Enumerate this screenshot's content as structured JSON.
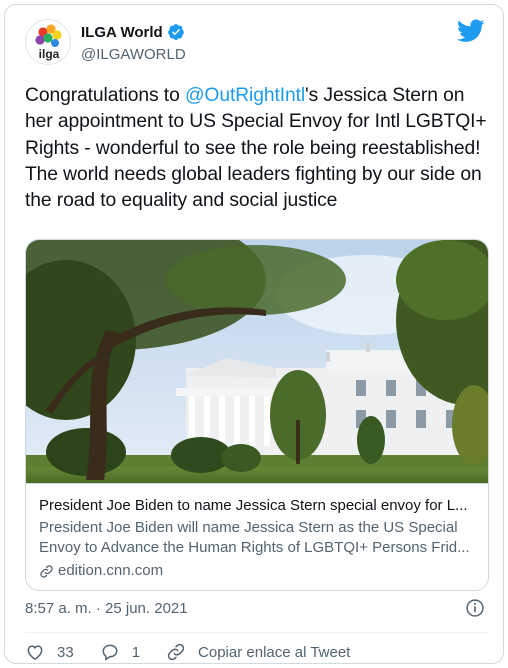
{
  "author": {
    "name": "ILGA World",
    "handle": "@ILGAWORLD",
    "avatar_text": "ilga",
    "verified": true
  },
  "tweet": {
    "text_before": "Congratulations to ",
    "mention": "@OutRightIntl",
    "text_after": "'s Jessica Stern on her appointment to US Special Envoy for Intl LGBTQI+ Rights - wonderful to see the role being reestablished! The world needs global leaders fighting by our side on the road to equality and social justice"
  },
  "link_card": {
    "title": "President Joe Biden to name Jessica Stern special envoy for L...",
    "description": "President Joe Biden will name Jessica Stern as the US Special Envoy to Advance the Human Rights of LGBTQI+ Persons Frid...",
    "domain": "edition.cnn.com"
  },
  "timestamp": "8:57 a. m. · 25 jun. 2021",
  "actions": {
    "likes": "33",
    "replies": "1",
    "copy_link_label": "Copiar enlace al Tweet"
  },
  "colors": {
    "accent": "#1d9bf0",
    "text": "#0f1419",
    "secondary": "#536471",
    "border": "#cfd9de"
  },
  "icons": {
    "brand": "twitter-bird-icon",
    "verified": "verified-badge-icon",
    "info": "info-icon",
    "like": "heart-icon",
    "reply": "reply-bubble-icon",
    "copy_link": "link-icon"
  }
}
